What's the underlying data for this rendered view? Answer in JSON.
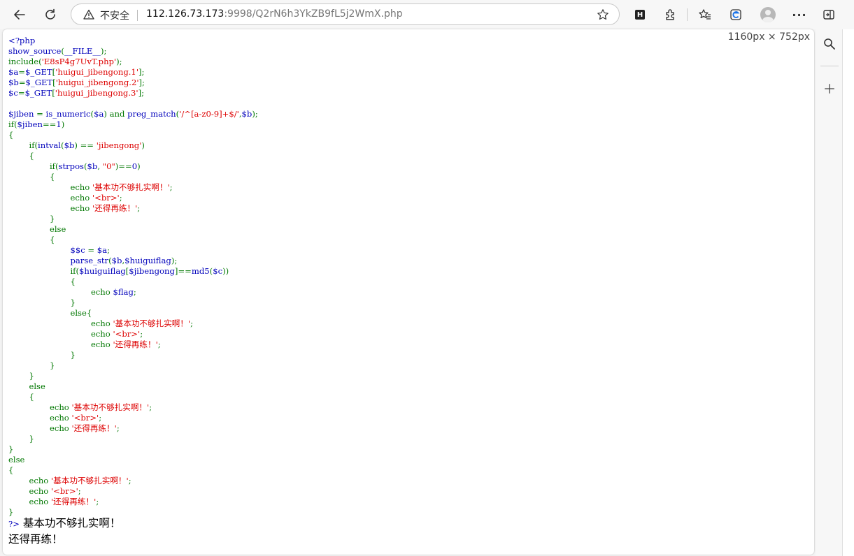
{
  "browser": {
    "security_label": "不安全",
    "url_host": "112.126.73.173",
    "url_rest": ":9998/Q2rN6h3YkZB9fL5j2WmX.php",
    "extension_badge": "H",
    "icons": [
      "back-icon",
      "reload-icon",
      "warning-icon",
      "star-icon",
      "extension-icon",
      "favorites-icon",
      "collections-icon",
      "profile-icon",
      "more-icon",
      "sidebar-icon",
      "search-icon",
      "add-icon"
    ]
  },
  "page": {
    "dimensions": "1160px × 752px",
    "source_lines": [
      [
        [
          "v",
          "<?php"
        ]
      ],
      [
        [
          "v",
          "show_source"
        ],
        [
          "k",
          "("
        ],
        [
          "v",
          "__FILE__"
        ],
        [
          "k",
          ");"
        ]
      ],
      [
        [
          "k",
          "include("
        ],
        [
          "s",
          "'E8sP4g7UvT.php'"
        ],
        [
          "k",
          ");"
        ]
      ],
      [
        [
          "v",
          "$a"
        ],
        [
          "k",
          "="
        ],
        [
          "v",
          "$_GET"
        ],
        [
          "k",
          "["
        ],
        [
          "s",
          "'huigui_jibengong.1'"
        ],
        [
          "k",
          "];"
        ]
      ],
      [
        [
          "v",
          "$b"
        ],
        [
          "k",
          "="
        ],
        [
          "v",
          "$_GET"
        ],
        [
          "k",
          "["
        ],
        [
          "s",
          "'huigui_jibengong.2'"
        ],
        [
          "k",
          "];"
        ]
      ],
      [
        [
          "v",
          "$c"
        ],
        [
          "k",
          "="
        ],
        [
          "v",
          "$_GET"
        ],
        [
          "k",
          "["
        ],
        [
          "s",
          "'huigui_jibengong.3'"
        ],
        [
          "k",
          "];"
        ]
      ],
      [],
      [
        [
          "v",
          "$jiben "
        ],
        [
          "k",
          "= "
        ],
        [
          "v",
          "is_numeric"
        ],
        [
          "k",
          "("
        ],
        [
          "v",
          "$a"
        ],
        [
          "k",
          ") and "
        ],
        [
          "v",
          "preg_match"
        ],
        [
          "k",
          "("
        ],
        [
          "s",
          "'/^[a-z0-9]+$/'"
        ],
        [
          "k",
          ","
        ],
        [
          "v",
          "$b"
        ],
        [
          "k",
          ");"
        ]
      ],
      [
        [
          "k",
          "if("
        ],
        [
          "v",
          "$jiben"
        ],
        [
          "k",
          "=="
        ],
        [
          "v",
          "1"
        ],
        [
          "k",
          ")"
        ]
      ],
      [
        [
          "k",
          "{"
        ]
      ],
      [
        [
          "k",
          "\tif("
        ],
        [
          "v",
          "intval"
        ],
        [
          "k",
          "("
        ],
        [
          "v",
          "$b"
        ],
        [
          "k",
          ") == "
        ],
        [
          "s",
          "'jibengong'"
        ],
        [
          "k",
          ")"
        ]
      ],
      [
        [
          "k",
          "\t{"
        ]
      ],
      [
        [
          "k",
          "\t\tif("
        ],
        [
          "v",
          "strpos"
        ],
        [
          "k",
          "("
        ],
        [
          "v",
          "$b"
        ],
        [
          "k",
          ", "
        ],
        [
          "s",
          "\"0\""
        ],
        [
          "k",
          ")=="
        ],
        [
          "v",
          "0"
        ],
        [
          "k",
          ")"
        ]
      ],
      [
        [
          "k",
          "\t\t{"
        ]
      ],
      [
        [
          "k",
          "\t\t\techo "
        ],
        [
          "s",
          "'基本功不够扎实啊！'"
        ],
        [
          "k",
          ";"
        ]
      ],
      [
        [
          "k",
          "\t\t\techo "
        ],
        [
          "s",
          "'<br>'"
        ],
        [
          "k",
          ";"
        ]
      ],
      [
        [
          "k",
          "\t\t\techo "
        ],
        [
          "s",
          "'还得再练！'"
        ],
        [
          "k",
          ";"
        ]
      ],
      [
        [
          "k",
          "\t\t}"
        ]
      ],
      [
        [
          "k",
          "\t\telse"
        ]
      ],
      [
        [
          "k",
          "\t\t{"
        ]
      ],
      [
        [
          "k",
          "\t\t\t"
        ],
        [
          "v",
          "$$c "
        ],
        [
          "k",
          "= "
        ],
        [
          "v",
          "$a"
        ],
        [
          "k",
          ";"
        ]
      ],
      [
        [
          "k",
          "\t\t\t"
        ],
        [
          "v",
          "parse_str"
        ],
        [
          "k",
          "("
        ],
        [
          "v",
          "$b"
        ],
        [
          "k",
          ","
        ],
        [
          "v",
          "$huiguiflag"
        ],
        [
          "k",
          ");"
        ]
      ],
      [
        [
          "k",
          "\t\t\tif("
        ],
        [
          "v",
          "$huiguiflag"
        ],
        [
          "k",
          "["
        ],
        [
          "v",
          "$jibengong"
        ],
        [
          "k",
          "]=="
        ],
        [
          "v",
          "md5"
        ],
        [
          "k",
          "("
        ],
        [
          "v",
          "$c"
        ],
        [
          "k",
          "))"
        ]
      ],
      [
        [
          "k",
          "\t\t\t{"
        ]
      ],
      [
        [
          "k",
          "\t\t\t\techo "
        ],
        [
          "v",
          "$flag"
        ],
        [
          "k",
          ";"
        ]
      ],
      [
        [
          "k",
          "\t\t\t}"
        ]
      ],
      [
        [
          "k",
          "\t\t\telse{"
        ]
      ],
      [
        [
          "k",
          "\t\t\t\techo "
        ],
        [
          "s",
          "'基本功不够扎实啊！'"
        ],
        [
          "k",
          ";"
        ]
      ],
      [
        [
          "k",
          "\t\t\t\techo "
        ],
        [
          "s",
          "'<br>'"
        ],
        [
          "k",
          ";"
        ]
      ],
      [
        [
          "k",
          "\t\t\t\techo "
        ],
        [
          "s",
          "'还得再练！'"
        ],
        [
          "k",
          ";"
        ]
      ],
      [
        [
          "k",
          "\t\t\t}"
        ]
      ],
      [
        [
          "k",
          "\t\t}"
        ]
      ],
      [
        [
          "k",
          "\t}"
        ]
      ],
      [
        [
          "k",
          "\telse"
        ]
      ],
      [
        [
          "k",
          "\t{"
        ]
      ],
      [
        [
          "k",
          "\t\techo "
        ],
        [
          "s",
          "'基本功不够扎实啊！'"
        ],
        [
          "k",
          ";"
        ]
      ],
      [
        [
          "k",
          "\t\techo "
        ],
        [
          "s",
          "'<br>'"
        ],
        [
          "k",
          ";"
        ]
      ],
      [
        [
          "k",
          "\t\techo "
        ],
        [
          "s",
          "'还得再练！'"
        ],
        [
          "k",
          ";"
        ]
      ],
      [
        [
          "k",
          "\t}"
        ]
      ],
      [
        [
          "k",
          "}"
        ]
      ],
      [
        [
          "k",
          "else"
        ]
      ],
      [
        [
          "k",
          "{"
        ]
      ],
      [
        [
          "k",
          "\techo "
        ],
        [
          "s",
          "'基本功不够扎实啊！'"
        ],
        [
          "k",
          ";"
        ]
      ],
      [
        [
          "k",
          "\techo "
        ],
        [
          "s",
          "'<br>'"
        ],
        [
          "k",
          ";"
        ]
      ],
      [
        [
          "k",
          "\techo "
        ],
        [
          "s",
          "'还得再练！'"
        ],
        [
          "k",
          ";"
        ]
      ],
      [
        [
          "k",
          "}"
        ]
      ]
    ],
    "closing_tag": "?>",
    "output_line_1": "基本功不够扎实啊！",
    "output_line_2": "还得再练！"
  }
}
